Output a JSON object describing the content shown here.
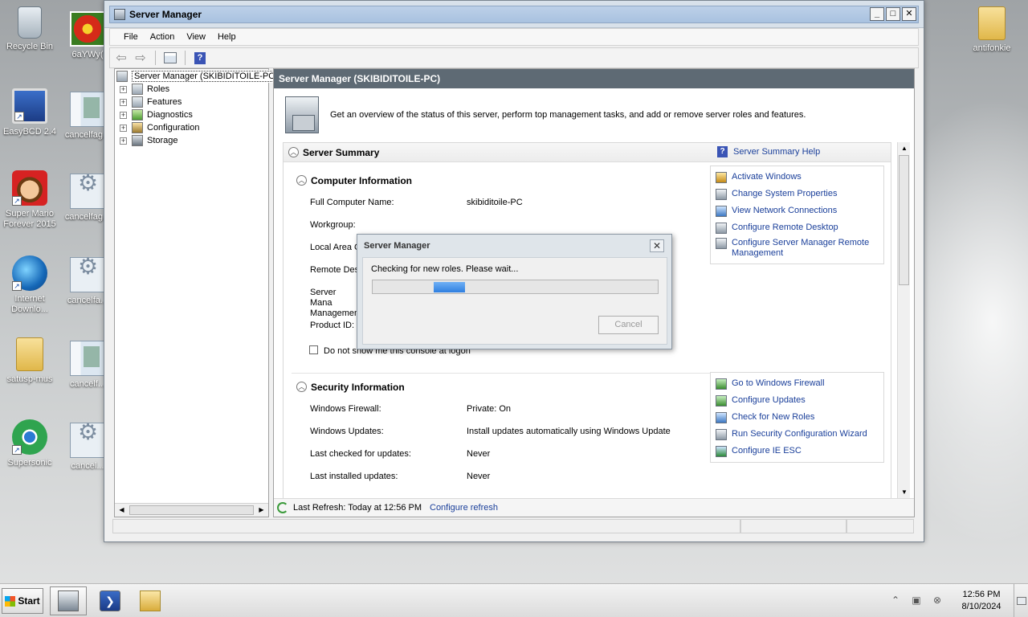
{
  "desktop": {
    "icons": [
      {
        "label": "Recycle Bin"
      },
      {
        "label": "6aYWy("
      },
      {
        "label": "EasyBCD 2.4"
      },
      {
        "label": "cancelfag..."
      },
      {
        "label": "Super Mario Forever 2015"
      },
      {
        "label": "cancelfag..."
      },
      {
        "label": "Internet Downlo..."
      },
      {
        "label": "cancelfa..."
      },
      {
        "label": "satusp-mus"
      },
      {
        "label": "cancelf..."
      },
      {
        "label": "Supersonic"
      },
      {
        "label": "cancel..."
      },
      {
        "label": "antifonkie"
      }
    ]
  },
  "window": {
    "title": "Server Manager",
    "controls": {
      "minimize": "_",
      "maximize": "□",
      "close": "✕"
    }
  },
  "menu": {
    "items": [
      "File",
      "Action",
      "View",
      "Help"
    ]
  },
  "toolbar": {
    "back": "⇦",
    "forward": "⇨",
    "help": "?"
  },
  "tree": {
    "root": "Server Manager (SKIBIDITOILE-PC)",
    "items": [
      {
        "label": "Roles"
      },
      {
        "label": "Features"
      },
      {
        "label": "Diagnostics"
      },
      {
        "label": "Configuration"
      },
      {
        "label": "Storage"
      }
    ]
  },
  "content": {
    "header": "Server Manager (SKIBIDITOILE-PC)",
    "overview": "Get an overview of the status of this server, perform top management tasks, and add or remove server roles and features.",
    "summary": {
      "title": "Server Summary",
      "help_link": "Server Summary Help",
      "computer_info": {
        "title": "Computer Information",
        "rows": [
          {
            "label": "Full Computer Name:",
            "value": "skibiditoile-PC"
          },
          {
            "label": "Workgroup:",
            "value": ""
          },
          {
            "label": "Local Area C",
            "value": ""
          },
          {
            "label": "Remote Des",
            "value": ""
          },
          {
            "label": "Server Mana Managemen",
            "value": ""
          },
          {
            "label": "Product ID:",
            "value": ""
          }
        ],
        "tasks": [
          {
            "label": "Activate Windows"
          },
          {
            "label": "Change System Properties"
          },
          {
            "label": "View Network Connections"
          },
          {
            "label": "Configure Remote Desktop"
          },
          {
            "label": "Configure Server Manager Remote Management"
          }
        ],
        "checkbox_label": "Do not show me this console at logon"
      },
      "security_info": {
        "title": "Security Information",
        "rows": [
          {
            "label": "Windows Firewall:",
            "value": "Private: On"
          },
          {
            "label": "Windows Updates:",
            "value": "Install updates automatically using Windows Update"
          },
          {
            "label": "Last checked for updates:",
            "value": "Never"
          },
          {
            "label": "Last installed updates:",
            "value": "Never"
          }
        ],
        "tasks": [
          {
            "label": "Go to Windows Firewall"
          },
          {
            "label": "Configure Updates"
          },
          {
            "label": "Check for New Roles"
          },
          {
            "label": "Run Security Configuration Wizard"
          },
          {
            "label": "Configure IE ESC"
          }
        ]
      }
    },
    "refresh": {
      "text": "Last Refresh: Today at 12:56 PM",
      "link": "Configure refresh"
    }
  },
  "dialog": {
    "title": "Server Manager",
    "close": "✕",
    "message": "Checking for new roles. Please wait...",
    "cancel": "Cancel"
  },
  "taskbar": {
    "start": "Start",
    "clock_time": "12:56 PM",
    "clock_date": "8/10/2024"
  }
}
